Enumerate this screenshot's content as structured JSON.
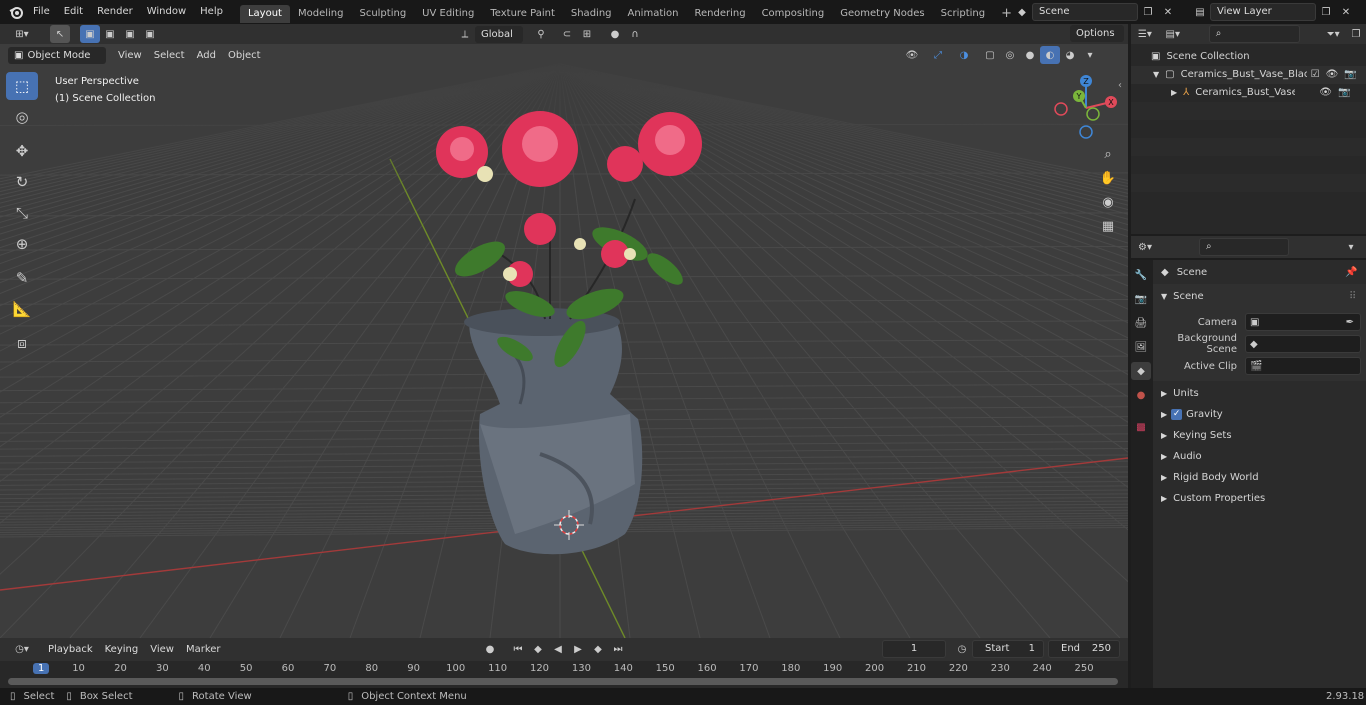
{
  "menu": {
    "items": [
      "File",
      "Edit",
      "Render",
      "Window",
      "Help"
    ],
    "workspaces": [
      "Layout",
      "Modeling",
      "Sculpting",
      "UV Editing",
      "Texture Paint",
      "Shading",
      "Animation",
      "Rendering",
      "Compositing",
      "Geometry Nodes",
      "Scripting"
    ],
    "active_workspace": "Layout",
    "add_tab": "+"
  },
  "scene_field": "Scene",
  "view_layer_field": "View Layer",
  "viewport": {
    "transform_orientation": "Global",
    "options_label": "Options",
    "mode": "Object Mode",
    "header_menus": [
      "View",
      "Select",
      "Add",
      "Object"
    ],
    "overlay_line1": "User Perspective",
    "overlay_line2": "(1) Scene Collection",
    "gizmo": {
      "z": "Z",
      "y": "Y",
      "x": "X"
    }
  },
  "outliner": {
    "root": "Scene Collection",
    "items": [
      {
        "label": "Ceramics_Bust_Vase_Black_v"
      },
      {
        "label": "Ceramics_Bust_Vase_Bla"
      }
    ]
  },
  "properties": {
    "context_title": "Scene",
    "panel_title": "Scene",
    "fields": [
      {
        "label": "Camera"
      },
      {
        "label": "Background Scene"
      },
      {
        "label": "Active Clip"
      }
    ],
    "panels": [
      "Units",
      "Gravity",
      "Keying Sets",
      "Audio",
      "Rigid Body World",
      "Custom Properties"
    ]
  },
  "timeline": {
    "menus": [
      "Playback",
      "Keying",
      "View",
      "Marker"
    ],
    "current_frame": "1",
    "start_label": "Start",
    "start_value": "1",
    "end_label": "End",
    "end_value": "250",
    "ticks": [
      "1",
      "10",
      "20",
      "30",
      "40",
      "50",
      "60",
      "70",
      "80",
      "90",
      "100",
      "110",
      "120",
      "130",
      "140",
      "150",
      "160",
      "170",
      "180",
      "190",
      "200",
      "210",
      "220",
      "230",
      "240",
      "250"
    ]
  },
  "statusbar": {
    "items": [
      "Select",
      "Box Select",
      "Rotate View",
      "Object Context Menu"
    ],
    "version": "2.93.18"
  },
  "colors": {
    "accent": "#4772b3",
    "x_axis": "#a33a3a",
    "y_axis": "#6e8b28",
    "gizmo_x": "#e04a5a",
    "gizmo_y": "#7bb63b",
    "gizmo_z": "#3f86d6"
  }
}
